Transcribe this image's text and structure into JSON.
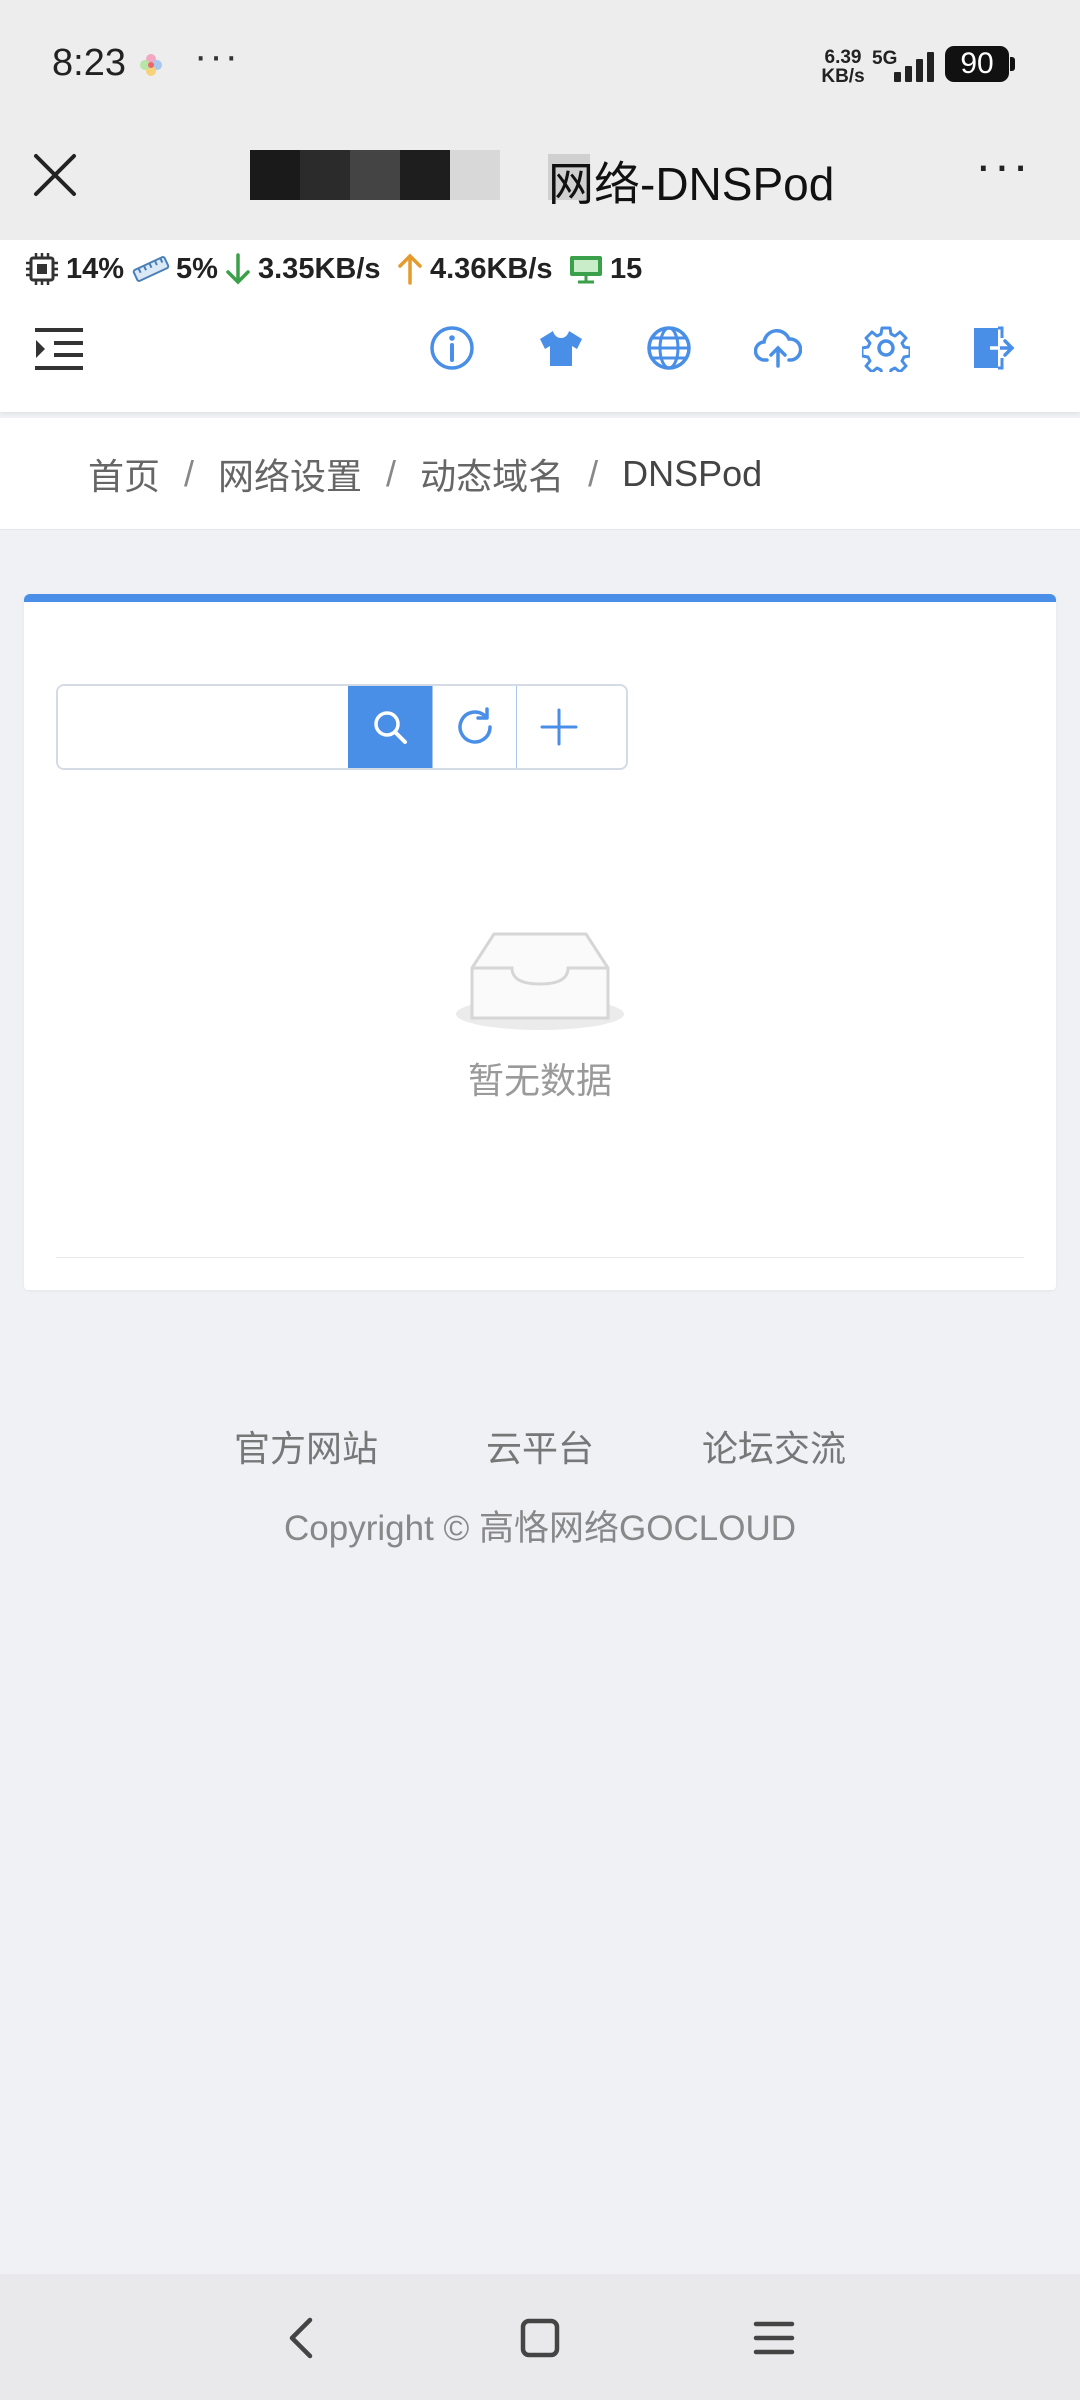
{
  "status_bar": {
    "time": "8:23",
    "more": "···",
    "net_speed": [
      "6.39",
      "KB/s"
    ],
    "network": "5G",
    "battery": "90"
  },
  "title_bar": {
    "title_visible": "网络-DNSPod",
    "more": "···"
  },
  "monitor": {
    "cpu": "14%",
    "mem": "5%",
    "download": "3.35KB/s",
    "upload": "4.36KB/s",
    "clients": "15",
    "colors": {
      "download": "#3aa14a",
      "upload": "#e59a2c",
      "clients": "#3aa14a"
    }
  },
  "header_icons": [
    "menu-toggle-icon",
    "info-icon",
    "tshirt-icon",
    "globe-icon",
    "cloud-upload-icon",
    "gear-icon",
    "logout-icon"
  ],
  "breadcrumb": [
    {
      "label": "首页"
    },
    {
      "label": "网络设置"
    },
    {
      "label": "动态域名"
    },
    {
      "label": "DNSPod"
    }
  ],
  "breadcrumb_sep": "/",
  "toolbar": {
    "search_value": "",
    "search_placeholder": ""
  },
  "empty_state": {
    "text": "暂无数据"
  },
  "footer": {
    "links": [
      "官方网站",
      "云平台",
      "论坛交流"
    ],
    "copyright": "Copyright © 高恪网络GOCLOUD"
  },
  "accent_color": "#4a8fe7"
}
